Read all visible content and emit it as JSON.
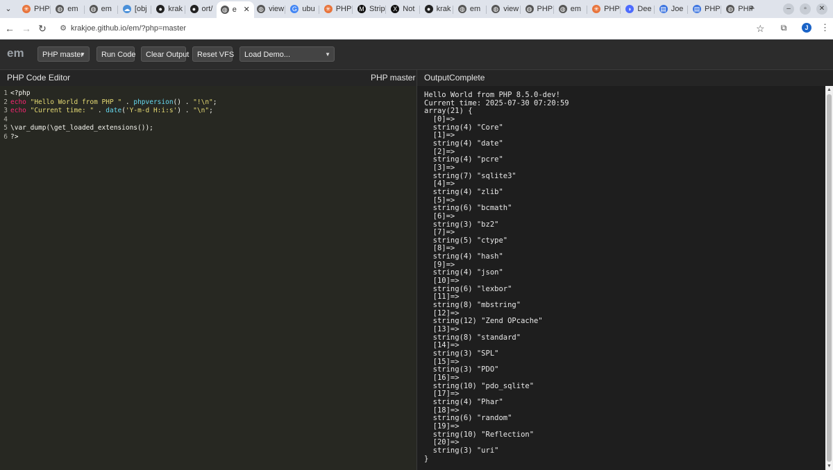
{
  "browser": {
    "tabs": [
      {
        "label": "PHP",
        "icon": "php-icon",
        "color": "#e8743b"
      },
      {
        "label": "em",
        "icon": "globe-icon",
        "color": "#555555"
      },
      {
        "label": "em",
        "icon": "globe-icon",
        "color": "#555555"
      },
      {
        "label": "[obj",
        "icon": "cloud-icon",
        "color": "#4a90d9"
      },
      {
        "label": "krak",
        "icon": "github-icon",
        "color": "#222222"
      },
      {
        "label": "ort/",
        "icon": "github-icon",
        "color": "#222222"
      },
      {
        "label": "e",
        "icon": "globe-icon",
        "color": "#555555",
        "active": true
      },
      {
        "label": "view",
        "icon": "globe-icon",
        "color": "#555555"
      },
      {
        "label": "ubu",
        "icon": "google-icon",
        "color": "#4285f4"
      },
      {
        "label": "PHP",
        "icon": "php-icon",
        "color": "#e8743b"
      },
      {
        "label": "Strip",
        "icon": "medium-icon",
        "color": "#111111"
      },
      {
        "label": "Not",
        "icon": "x-icon",
        "color": "#111111"
      },
      {
        "label": "krak",
        "icon": "github-icon",
        "color": "#222222"
      },
      {
        "label": "em",
        "icon": "globe-icon",
        "color": "#555555"
      },
      {
        "label": "view",
        "icon": "globe-icon",
        "color": "#555555"
      },
      {
        "label": "PHP",
        "icon": "globe-icon",
        "color": "#555555"
      },
      {
        "label": "em",
        "icon": "globe-icon",
        "color": "#555555"
      },
      {
        "label": "PHP",
        "icon": "php-icon",
        "color": "#e8743b"
      },
      {
        "label": "Dee",
        "icon": "deepseek-icon",
        "color": "#4d6bfe"
      },
      {
        "label": "Joe",
        "icon": "docs-icon",
        "color": "#3b74e0"
      },
      {
        "label": "PHP",
        "icon": "docs-icon",
        "color": "#3b74e0"
      },
      {
        "label": "PHP",
        "icon": "globe-icon",
        "color": "#555555"
      }
    ],
    "close_tab_glyph": "✕",
    "new_tab_glyph": "+",
    "url": "krakjoe.github.io/em/?php=master"
  },
  "app": {
    "logo": "em",
    "version_select": "PHP master",
    "run_button": "Run Code",
    "clear_button": "Clear Output",
    "reset_button": "Reset VFS",
    "demo_select": "Load Demo..."
  },
  "editor": {
    "title": "PHP Code Editor",
    "version_label": "PHP master",
    "lines": [
      [
        {
          "t": "<?php",
          "c": "def"
        }
      ],
      [
        {
          "t": "echo ",
          "c": "kw"
        },
        {
          "t": "\"Hello World from PHP \"",
          "c": "str"
        },
        {
          "t": " . ",
          "c": "def"
        },
        {
          "t": "phpversion",
          "c": "fn"
        },
        {
          "t": "() . ",
          "c": "def"
        },
        {
          "t": "\"!\\n\"",
          "c": "str"
        },
        {
          "t": ";",
          "c": "def"
        }
      ],
      [
        {
          "t": "echo ",
          "c": "kw"
        },
        {
          "t": "\"Current time: \"",
          "c": "str"
        },
        {
          "t": " . ",
          "c": "def"
        },
        {
          "t": "date",
          "c": "fn"
        },
        {
          "t": "(",
          "c": "def"
        },
        {
          "t": "'Y-m-d H:i:s'",
          "c": "str"
        },
        {
          "t": ") . ",
          "c": "def"
        },
        {
          "t": "\"\\n\"",
          "c": "str"
        },
        {
          "t": ";",
          "c": "def"
        }
      ],
      [],
      [
        {
          "t": "\\var_dump(\\get_loaded_extensions());",
          "c": "def"
        }
      ],
      [
        {
          "t": "?>",
          "c": "def"
        }
      ]
    ]
  },
  "output": {
    "title": "OutputComplete",
    "text": "Hello World from PHP 8.5.0-dev!\nCurrent time: 2025-07-30 07:20:59\narray(21) {\n  [0]=>\n  string(4) \"Core\"\n  [1]=>\n  string(4) \"date\"\n  [2]=>\n  string(4) \"pcre\"\n  [3]=>\n  string(7) \"sqlite3\"\n  [4]=>\n  string(4) \"zlib\"\n  [5]=>\n  string(6) \"bcmath\"\n  [6]=>\n  string(3) \"bz2\"\n  [7]=>\n  string(5) \"ctype\"\n  [8]=>\n  string(4) \"hash\"\n  [9]=>\n  string(4) \"json\"\n  [10]=>\n  string(6) \"lexbor\"\n  [11]=>\n  string(8) \"mbstring\"\n  [12]=>\n  string(12) \"Zend OPcache\"\n  [13]=>\n  string(8) \"standard\"\n  [14]=>\n  string(3) \"SPL\"\n  [15]=>\n  string(3) \"PDO\"\n  [16]=>\n  string(10) \"pdo_sqlite\"\n  [17]=>\n  string(4) \"Phar\"\n  [18]=>\n  string(6) \"random\"\n  [19]=>\n  string(10) \"Reflection\"\n  [20]=>\n  string(3) \"uri\"\n}"
  }
}
